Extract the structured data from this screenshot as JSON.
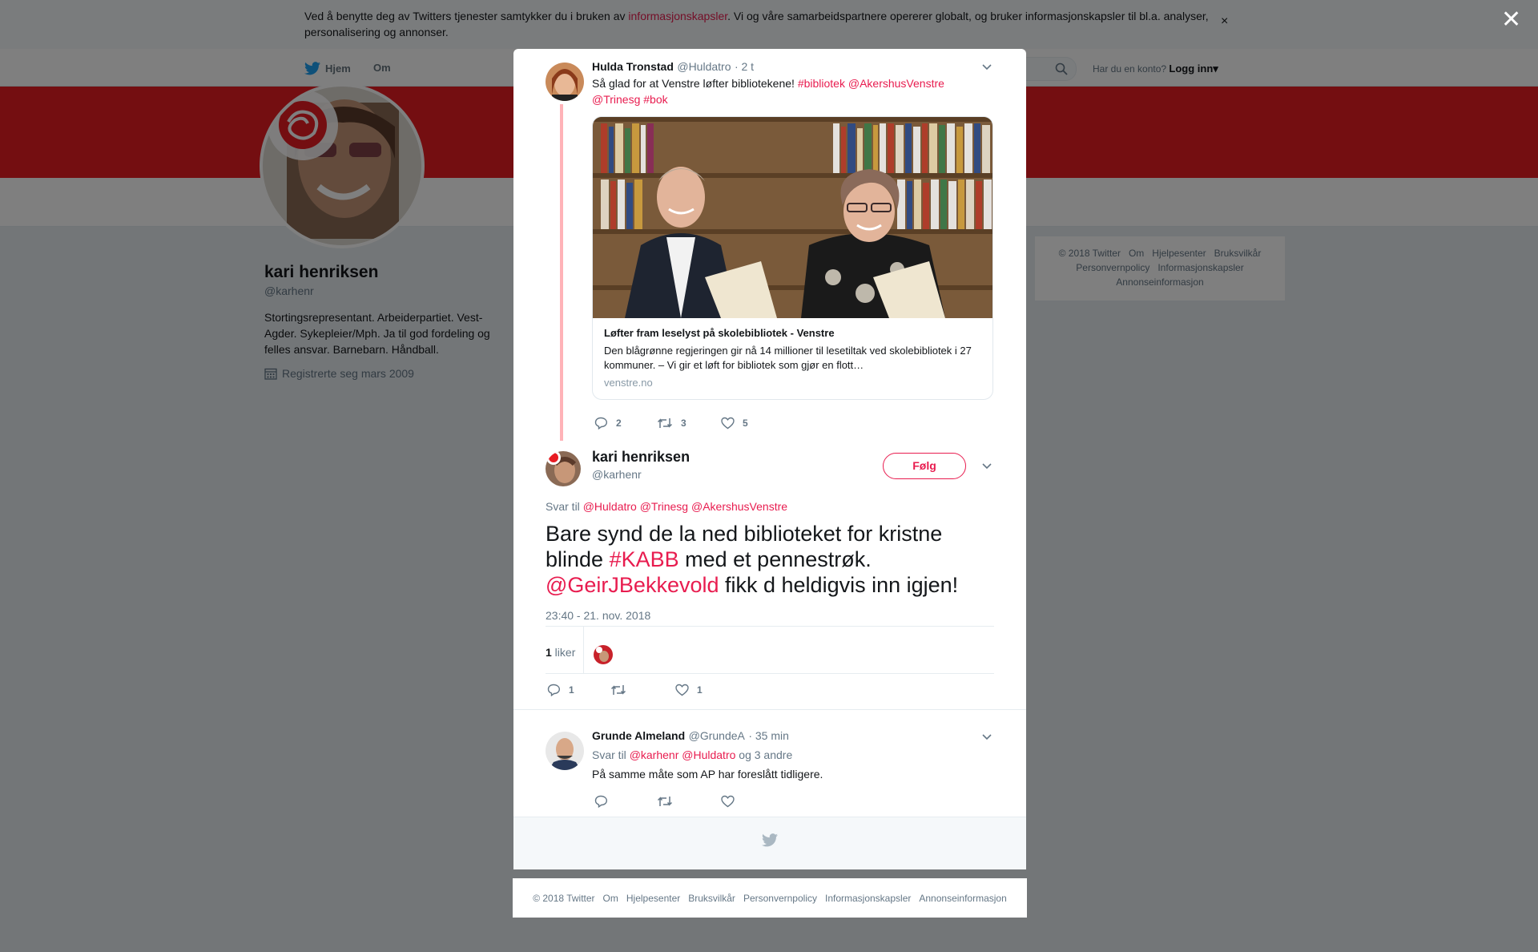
{
  "cookie": {
    "text_before": "Ved å benytte deg av Twitters tjenester samtykker du i bruken av ",
    "link": "informasjonskapsler",
    "text_after": ". Vi og våre samarbeidspartnere opererer globalt, og bruker informasjonskapsler til bl.a. analyser, personalisering og annonser.",
    "close": "×"
  },
  "nav": {
    "home": "Hjem",
    "about": "Om",
    "account_prompt": "Har du en konto?",
    "login": "Logg inn",
    "login_caret": "▾"
  },
  "profile": {
    "name": "kari henriksen",
    "handle": "@karhenr",
    "bio": "Stortingsrepresentant. Arbeiderpartiet. Vest-Agder. Sykepleier/Mph. Ja til god fordeling og felles ansvar. Barnebarn. Håndball.",
    "joined": "Registrerte seg mars 2009"
  },
  "side_footer": {
    "row1": [
      "© 2018 Twitter",
      "Om",
      "Hjelpesenter",
      "Bruksvilkår"
    ],
    "row2": [
      "Personvernpolicy",
      "Informasjonskapsler"
    ],
    "row3": [
      "Annonseinformasjon"
    ]
  },
  "overlay_close": "✕",
  "tweet1": {
    "name": "Hulda Tronstad",
    "handle": "@Huldatro",
    "time": "· 2 t",
    "text_plain1": "Så glad for at Venstre løfter bibliotekene! ",
    "tag1": "#bibliotek",
    "space1": " ",
    "mention1": "@AkershusVenstre",
    "mention2": "@Trinesg",
    "space2": " ",
    "tag2": "#bok",
    "card": {
      "title": "Løfter fram leselyst på skolebibliotek - Venstre",
      "desc": "Den blågrønne regjeringen gir nå 14 millioner til lesetiltak ved skolebibliotek i 27 kommuner. – Vi gir et løft for bibliotek som gjør en flott…",
      "url": "venstre.no"
    },
    "replies": "2",
    "retweets": "3",
    "likes": "5"
  },
  "main_tweet": {
    "name": "kari henriksen",
    "handle": "@karhenr",
    "follow": "Følg",
    "reply_label": "Svar til ",
    "reply_mentions": [
      "@Huldatro",
      "@Trinesg",
      "@AkershusVenstre"
    ],
    "text1": "Bare synd de la ned biblioteket for kristne blinde ",
    "hashtag": "#KABB",
    "text2": " med et pennestrøk. ",
    "mention": "@GeirJBekkevold",
    "text3": " fikk d heldigvis inn igjen!",
    "timestamp": "23:40 - 21. nov. 2018",
    "likes_number": "1",
    "likes_word": " liker",
    "replies": "1",
    "likes": "1"
  },
  "tweet3": {
    "name": "Grunde Almeland",
    "handle": "@GrundeA",
    "time": "· 35 min",
    "reply_label": "Svar til ",
    "mention1": "@karhenr",
    "mention2": "@Huldatro",
    "others": " og 3 andre",
    "text": "På samme måte som AP har foreslått tidligere."
  },
  "bottom_footer": [
    "© 2018 Twitter",
    "Om",
    "Hjelpesenter",
    "Bruksvilkår",
    "Personvernpolicy",
    "Informasjonskapsler",
    "Annonseinformasjon"
  ],
  "colors": {
    "accent": "#e81c4f",
    "banner": "#e81c23",
    "thread_line": "#ffb3b8",
    "text": "#14171a",
    "muted": "#657786"
  }
}
